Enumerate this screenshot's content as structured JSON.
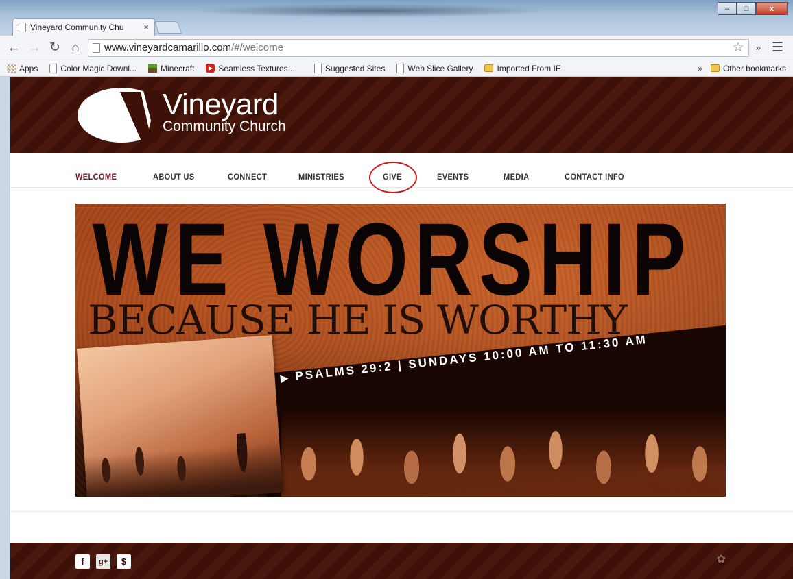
{
  "browser": {
    "tab_title": "Vineyard Community Chu",
    "tab_close": "×",
    "url_host": "www.vineyardcamarillo.com",
    "url_path": "/#/welcome",
    "overflow_label": "»",
    "window_minimize": "–",
    "window_maximize": "□",
    "window_close": "x"
  },
  "bookmarks": {
    "items": [
      {
        "label": "Apps",
        "icon": "apps-grid-icon"
      },
      {
        "label": "Color Magic Downl...",
        "icon": "page-icon"
      },
      {
        "label": "Minecraft",
        "icon": "minecraft-icon"
      },
      {
        "label": "Seamless Textures ...",
        "icon": "youtube-icon"
      },
      {
        "label": "Suggested Sites",
        "icon": "page-icon"
      },
      {
        "label": "Web Slice Gallery",
        "icon": "page-icon"
      },
      {
        "label": "Imported From IE",
        "icon": "folder-icon"
      }
    ],
    "overflow": "»",
    "other": "Other bookmarks"
  },
  "site": {
    "logo_name": "Vineyard",
    "logo_sub": "Community Church",
    "nav": [
      "WELCOME",
      "ABOUT US",
      "CONNECT",
      "MINISTRIES",
      "GIVE",
      "EVENTS",
      "MEDIA",
      "CONTACT INFO"
    ],
    "active_nav": "WELCOME",
    "annotated_nav": "GIVE",
    "banner": {
      "headline": "WE WORSHIP",
      "subhead": "BECAUSE HE IS WORTHY",
      "scripture": "PSALMS 29:2 | SUNDAYS 10:00 AM TO 11:30 AM"
    },
    "footer_social": [
      "facebook-icon",
      "google-plus-icon",
      "dollar-icon"
    ]
  },
  "colors": {
    "header_brown": "#3d1108",
    "active_nav": "#6a1020",
    "annotation_red": "#d21a1a"
  }
}
